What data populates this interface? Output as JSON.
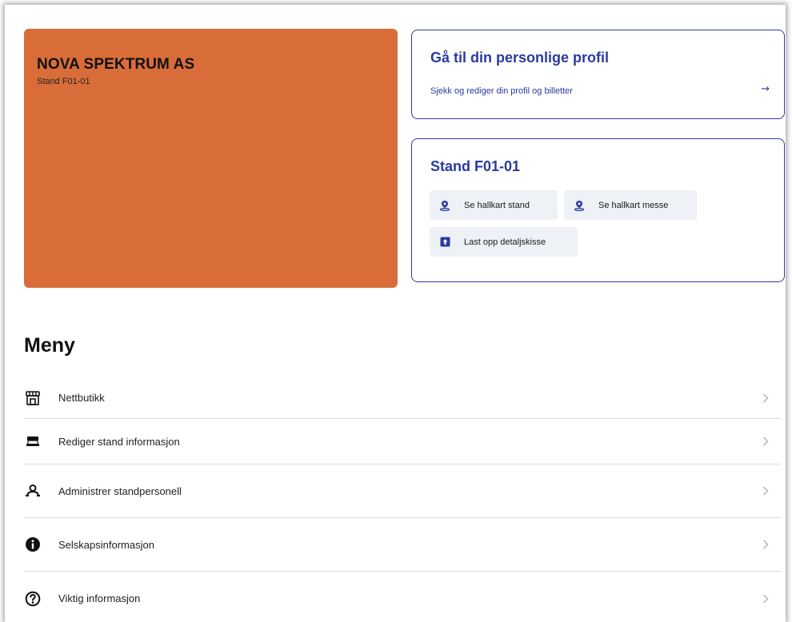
{
  "company": {
    "name": "NOVA SPEKTRUM AS",
    "stand": "Stand F01-01",
    "color": "#d96d39"
  },
  "profile_card": {
    "title": "Gå til din personlige profil",
    "subtitle": "Sjekk og rediger din profil og billetter",
    "arrow": "→",
    "accent": "#2b3aa0"
  },
  "stand_card": {
    "title": "Stand F01-01",
    "actions": [
      {
        "label": "Se hallkart stand",
        "icon": "map-pin-icon"
      },
      {
        "label": "Se hallkart messe",
        "icon": "map-pin-icon"
      },
      {
        "label": "Last opp detaljskisse",
        "icon": "upload-icon"
      }
    ]
  },
  "menu": {
    "title": "Meny",
    "items": [
      {
        "label": "Nettbutikk",
        "icon": "store-icon"
      },
      {
        "label": "Rediger stand informasjon",
        "icon": "booth-icon"
      },
      {
        "label": "Administrer standpersonell",
        "icon": "users-icon"
      },
      {
        "label": "Selskapsinformasjon",
        "icon": "info-icon"
      },
      {
        "label": "Viktig informasjon",
        "icon": "help-icon"
      }
    ]
  }
}
